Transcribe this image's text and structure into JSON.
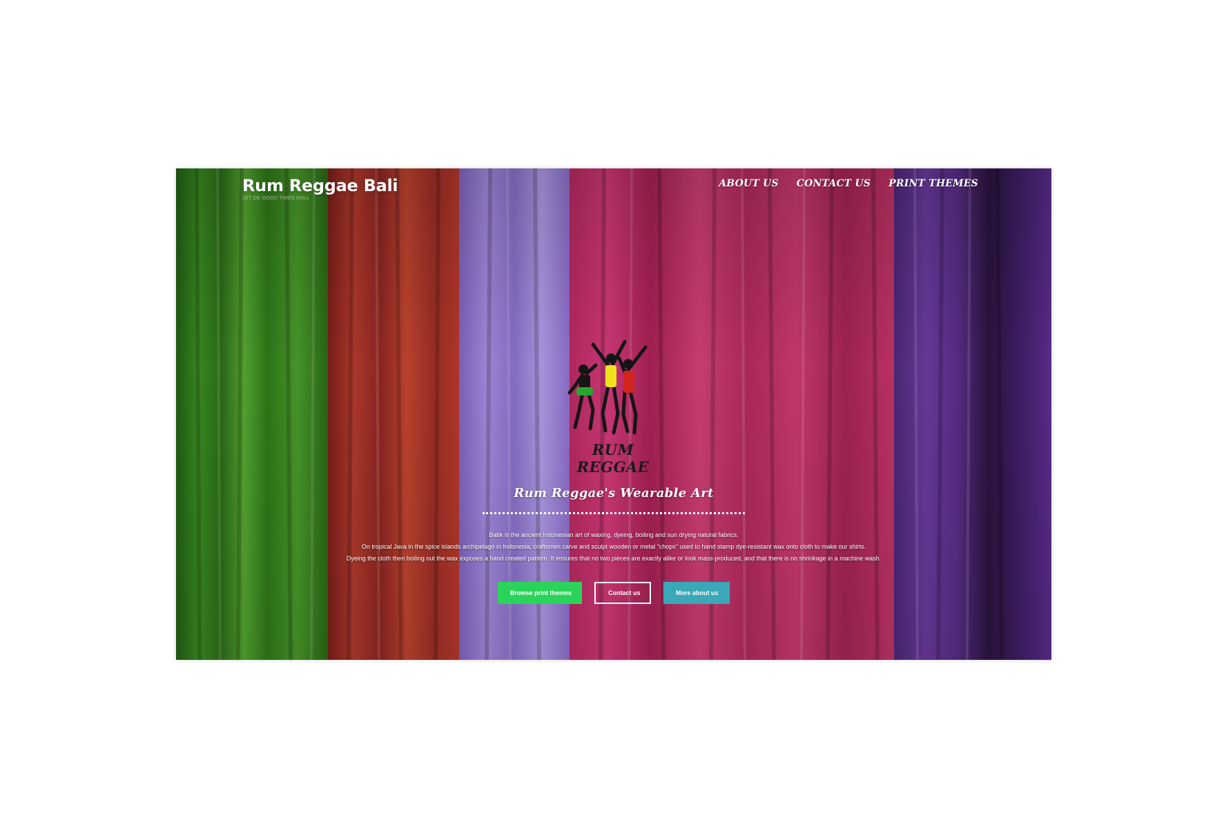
{
  "header": {
    "site_title": "Rum Reggae Bali",
    "tagline": "LET DE GOOD TIMES ROLL"
  },
  "nav": {
    "items": [
      {
        "label": "About us"
      },
      {
        "label": "Contact us"
      },
      {
        "label": "Print themes"
      }
    ]
  },
  "logo": {
    "text": "RUM REGGAE"
  },
  "main": {
    "headline": "Rum Reggae's Wearable Art",
    "paragraphs": [
      "Batik is the ancient Indonesian art of waxing, dyeing, boiling and sun drying natural fabrics.",
      "On tropical Java in the spice islands archipelago in Indonesia, craftsmen carve and sculpt wooden or metal \"chops\" used to hand stamp dye-resistant wax onto cloth to make our shirts.",
      "Dyeing the cloth then boiling out the wax exposes a hand created pattern. It ensures that no two pieces are exactly alike or look mass-produced, and that there is no shrinkage in a machine wash."
    ],
    "buttons": {
      "browse": "Browse print themes",
      "contact": "Contact us",
      "more": "More about us"
    }
  },
  "colors": {
    "btn_green": "#2ad45a",
    "btn_teal": "#3aa8b8",
    "fabric_green": "#3f8f23",
    "fabric_red": "#b52e2e",
    "fabric_lavender": "#9b7fd0",
    "fabric_magenta": "#c62e6b",
    "fabric_purple": "#5a2a8a"
  }
}
